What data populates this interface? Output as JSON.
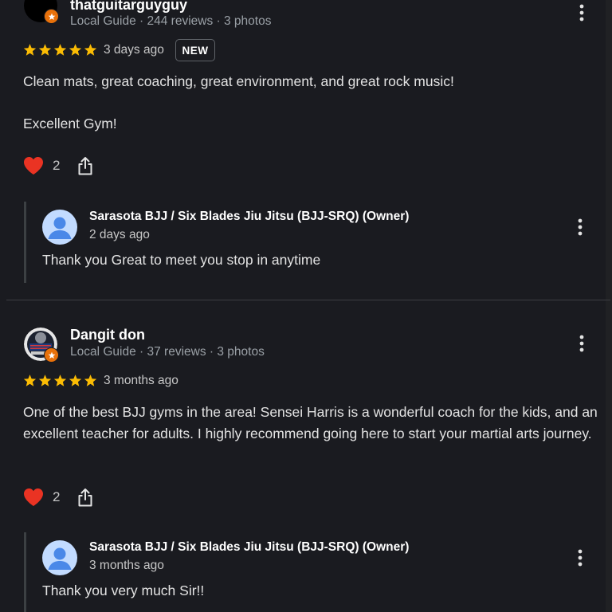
{
  "reviews": [
    {
      "reviewer": {
        "name": "thatguitarguyguy",
        "meta": "Local Guide · 244 reviews · 3 photos"
      },
      "rating": 5,
      "date": "3 days ago",
      "badge": "NEW",
      "paragraphs": [
        "Clean mats, great coaching, great environment, and great rock music!",
        "Excellent Gym!"
      ],
      "likes": "2",
      "owner_reply": {
        "name": "Sarasota BJJ / Six Blades Jiu Jitsu (BJJ-SRQ) (Owner)",
        "date": "2 days ago",
        "text": "Thank you Great to meet you stop in anytime"
      }
    },
    {
      "reviewer": {
        "name": "Dangit don",
        "meta": "Local Guide · 37 reviews · 3 photos"
      },
      "rating": 5,
      "date": "3 months ago",
      "paragraphs": [
        "One of the best BJJ gyms in the area! Sensei Harris is a wonderful coach for the kids, and an excellent teacher for adults. I highly recommend going here to start your martial arts journey."
      ],
      "likes": "2",
      "owner_reply": {
        "name": "Sarasota BJJ / Six Blades Jiu Jitsu (BJJ-SRQ) (Owner)",
        "date": "3 months ago",
        "text": "Thank you very much Sir!!"
      }
    }
  ],
  "icons": {
    "star": "star-icon",
    "heart": "heart-icon",
    "share": "share-icon",
    "more": "more-vert-icon",
    "local_guide": "local-guide-badge-icon",
    "default_avatar": "person-avatar-icon"
  },
  "colors": {
    "background": "#1a1b20",
    "star": "#fbbc04",
    "heart": "#ea3323",
    "local_guide_badge": "#e8710a",
    "owner_avatar_bg": "#c2dbff",
    "owner_avatar_fg": "#4a88e8"
  }
}
